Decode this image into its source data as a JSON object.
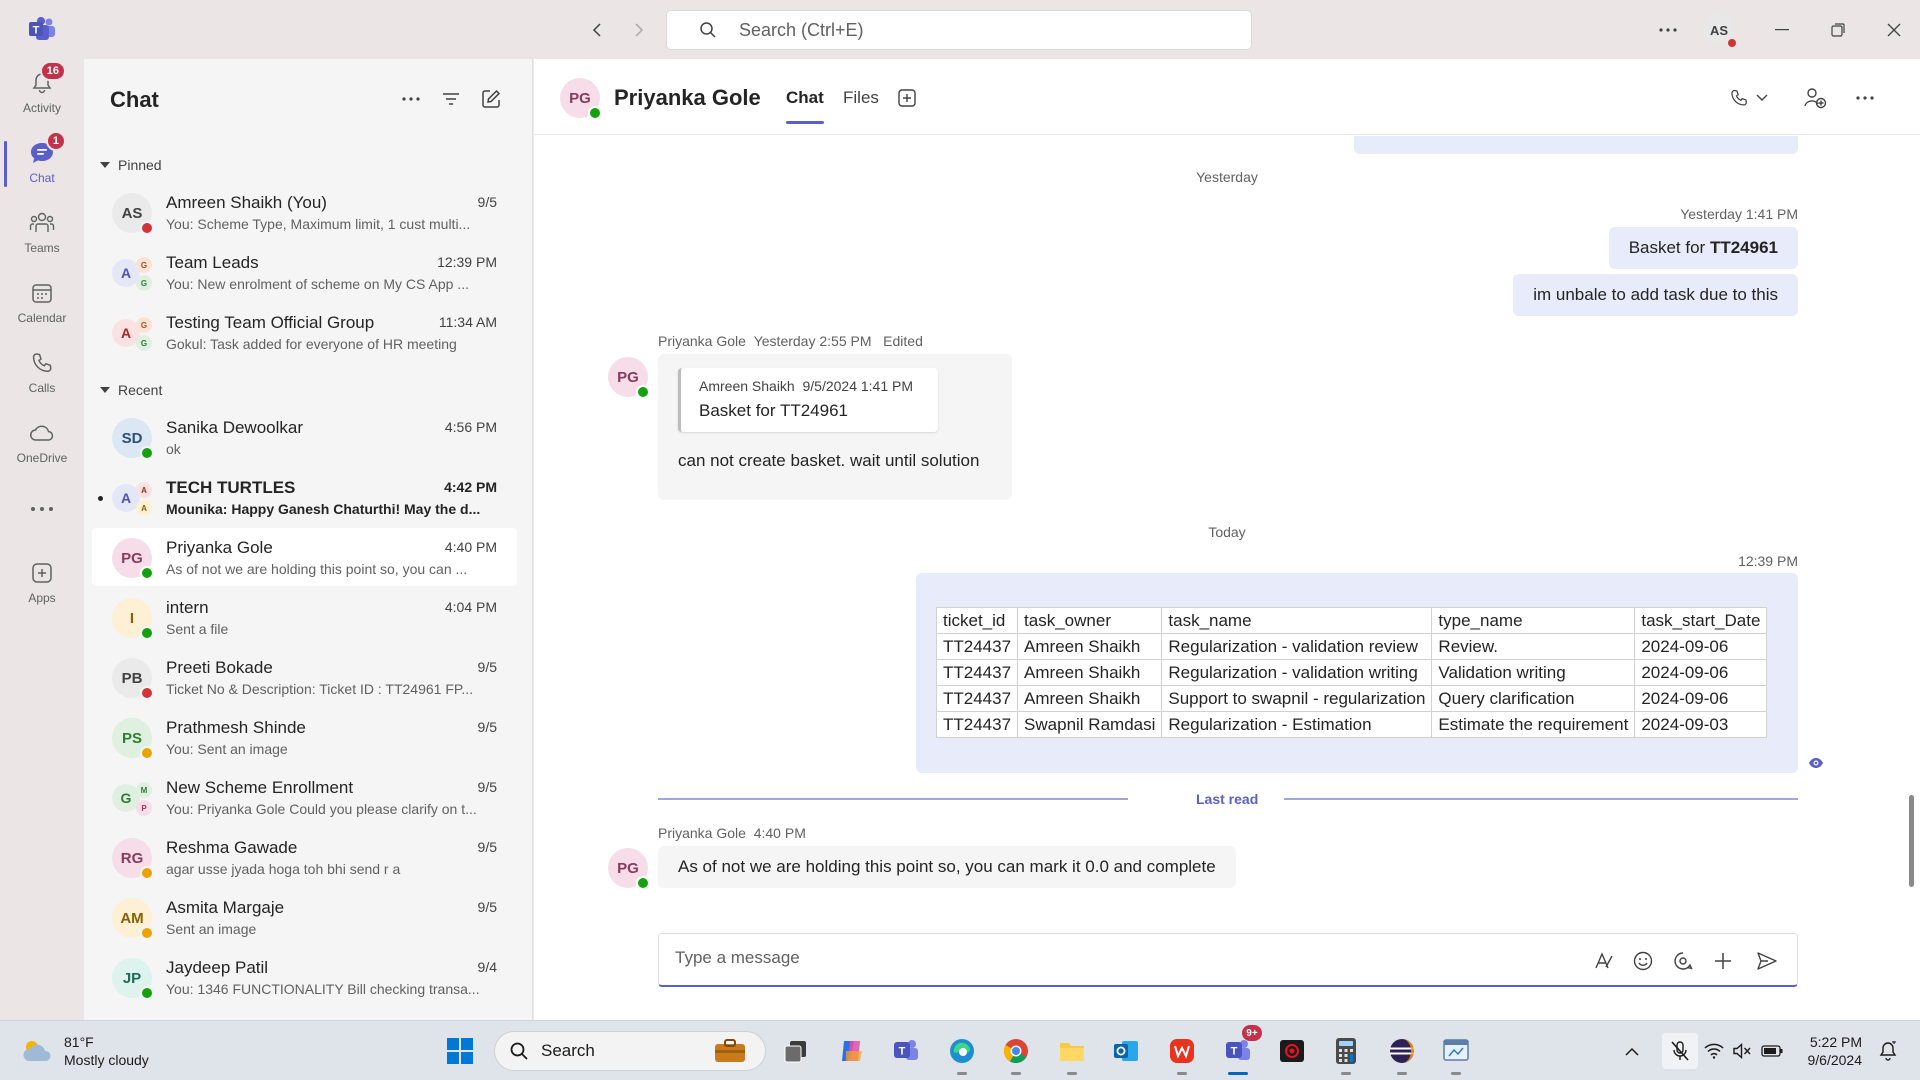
{
  "titlebar": {
    "search_placeholder": "Search (Ctrl+E)",
    "user_initials": "AS"
  },
  "rail": {
    "activity": {
      "label": "Activity",
      "badge": "16"
    },
    "chat": {
      "label": "Chat",
      "badge": "1"
    },
    "teams": {
      "label": "Teams"
    },
    "calendar": {
      "label": "Calendar"
    },
    "calls": {
      "label": "Calls"
    },
    "onedrive": {
      "label": "OneDrive"
    },
    "apps": {
      "label": "Apps"
    }
  },
  "chatlist": {
    "title": "Chat",
    "pinned_label": "Pinned",
    "recent_label": "Recent",
    "pinned": [
      {
        "initials": "AS",
        "name": "Amreen Shaikh (You)",
        "time": "9/5",
        "preview": "You: Scheme Type, Maximum limit, 1 cust multi...",
        "status": "red"
      },
      {
        "initials": "A",
        "sub": [
          "G",
          "G"
        ],
        "name": "Team Leads",
        "time": "12:39 PM",
        "preview": "You: New enrolment of scheme on My CS App ..."
      },
      {
        "initials": "A",
        "sub": [
          "G",
          "G"
        ],
        "name": "Testing Team Official Group",
        "time": "11:34 AM",
        "preview": "Gokul: Task added for everyone of HR meeting"
      }
    ],
    "recent": [
      {
        "initials": "SD",
        "name": "Sanika Dewoolkar",
        "time": "4:56 PM",
        "preview": "ok",
        "status": "green"
      },
      {
        "initials": "A",
        "sub": [
          "A",
          "A"
        ],
        "name": "TECH TURTLES",
        "time": "4:42 PM",
        "preview": "Mounika: Happy Ganesh Chaturthi! May the d...",
        "unread": true
      },
      {
        "initials": "PG",
        "name": "Priyanka Gole",
        "time": "4:40 PM",
        "preview": "As of not we are holding this point so, you can ...",
        "status": "green",
        "selected": true
      },
      {
        "initials": "I",
        "name": "intern",
        "time": "4:04 PM",
        "preview": "Sent a file",
        "status": "green"
      },
      {
        "initials": "PB",
        "name": "Preeti Bokade",
        "time": "9/5",
        "preview": "Ticket No & Description: Ticket ID : TT24961 FP...",
        "status": "red"
      },
      {
        "initials": "PS",
        "name": "Prathmesh Shinde",
        "time": "9/5",
        "preview": "You: Sent an image",
        "status": "amber"
      },
      {
        "initials": "G",
        "sub": [
          "M",
          "P"
        ],
        "name": "New Scheme Enrollment",
        "time": "9/5",
        "preview": "You: Priyanka Gole Could you please clarify on t..."
      },
      {
        "initials": "RG",
        "name": "Reshma Gawade",
        "time": "9/5",
        "preview": "agar usse jyada hoga toh bhi send r a",
        "status": "amber"
      },
      {
        "initials": "AM",
        "name": "Asmita Margaje",
        "time": "9/5",
        "preview": "Sent an image",
        "status": "amber"
      },
      {
        "initials": "JP",
        "name": "Jaydeep Patil",
        "time": "9/4",
        "preview": "You: 1346 FUNCTIONALITY Bill checking transa...",
        "status": "green"
      }
    ]
  },
  "conversation": {
    "contact_initials": "PG",
    "contact_name": "Priyanka Gole",
    "tabs": {
      "chat": "Chat",
      "files": "Files"
    },
    "day_yesterday": "Yesterday",
    "day_today": "Today",
    "my_msg_time_1": "Yesterday 1:41 PM",
    "my_msg_1_prefix": "Basket for ",
    "my_msg_1_bold": "TT24961",
    "my_msg_2": "im unbale to add task due to this",
    "their_msg_1_sender": "Priyanka Gole",
    "their_msg_1_time": "Yesterday 2:55 PM",
    "their_msg_1_edited": "Edited",
    "quote_sender": "Amreen Shaikh",
    "quote_time": "9/5/2024 1:41 PM",
    "quote_text": "Basket for TT24961",
    "their_msg_1_text": "can not create basket. wait until solution",
    "my_table_time": "12:39 PM",
    "table": {
      "headers": [
        "ticket_id",
        "task_owner",
        "task_name",
        "type_name",
        "task_start_Date"
      ],
      "rows": [
        [
          "TT24437",
          "Amreen Shaikh",
          "Regularization - validation review",
          "Review.",
          "2024-09-06"
        ],
        [
          "TT24437",
          "Amreen Shaikh",
          "Regularization - validation writing",
          "Validation writing",
          "2024-09-06"
        ],
        [
          "TT24437",
          "Amreen Shaikh",
          "Support to swapnil - regularization",
          "Query clarification",
          "2024-09-06"
        ],
        [
          "TT24437",
          "Swapnil Ramdasi",
          "Regularization - Estimation",
          "Estimate the requirement",
          "2024-09-03"
        ]
      ]
    },
    "last_read": "Last read",
    "their_msg_2_sender": "Priyanka Gole",
    "their_msg_2_time": "4:40 PM",
    "their_msg_2_text": "As of not we are holding this point so, you can mark it 0.0 and complete",
    "composer_placeholder": "Type a message"
  },
  "taskbar": {
    "weather_temp": "81°F",
    "weather_desc": "Mostly cloudy",
    "search_label": "Search",
    "teams_badge": "9+",
    "time": "5:22 PM",
    "date": "9/6/2024"
  },
  "colors": {
    "accent": "#5b5fc7",
    "my_bubble": "#e8ebfa",
    "status_available": "#13a10e",
    "status_busy": "#d13438",
    "status_away": "#eaa300"
  }
}
